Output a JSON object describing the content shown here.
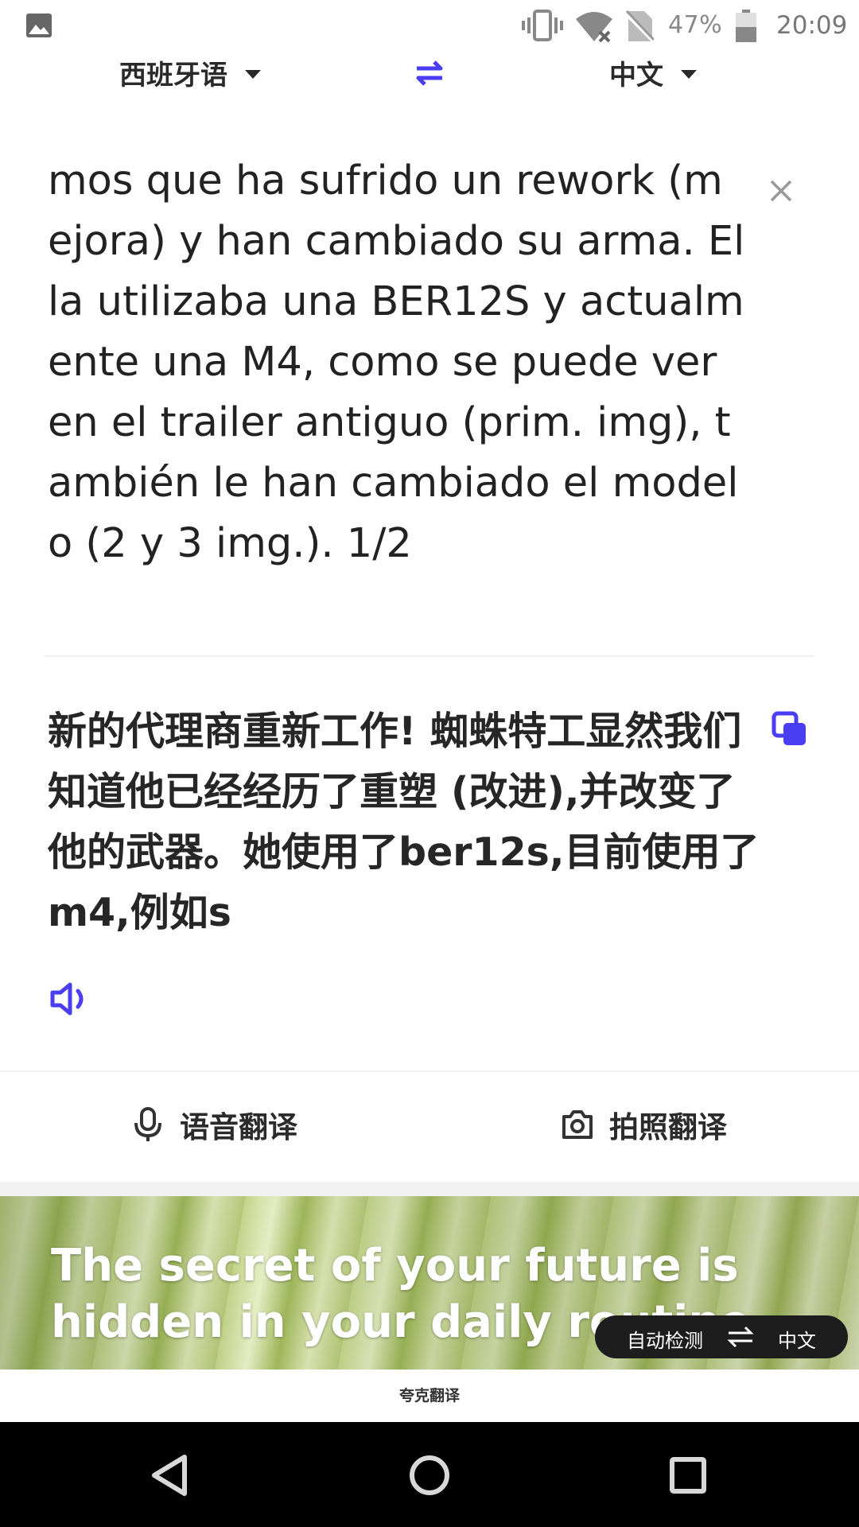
{
  "status_bar": {
    "battery_percent": "47%",
    "time": "20:09",
    "icons": [
      "gallery-icon",
      "vibrate-icon",
      "wifi-icon",
      "no-sim-icon",
      "battery-icon"
    ]
  },
  "language_bar": {
    "source_language": "西班牙语",
    "target_language": "中文",
    "swap_icon": "swap-arrows-icon",
    "accent_color": "#4b3df2"
  },
  "source": {
    "text": "mos que ha sufrido un rework (mejora) y han cambiado su arma. Ella utilizaba una BER12S y actualmente una M4, como se puede ver en el trailer antiguo (prim. img), también le han cambiado el modelo (2 y 3 img.). 1/2"
  },
  "translation": {
    "text": "新的代理商重新工作! 蜘蛛特工显然我们知道他已经经历了重塑 (改进),并改变了他的武器。她使用了ber12s,目前使用了m4,例如s"
  },
  "actions": {
    "voice_label": "语音翻译",
    "photo_label": "拍照翻译"
  },
  "banner": {
    "quote": "The secret of your future is hidden in your daily routine.",
    "pill_source": "自动检测",
    "pill_target": "中文"
  },
  "footer": {
    "app_name": "夸克翻译"
  },
  "nav_bar": {
    "icons": [
      "back-icon",
      "home-icon",
      "recents-icon"
    ]
  }
}
